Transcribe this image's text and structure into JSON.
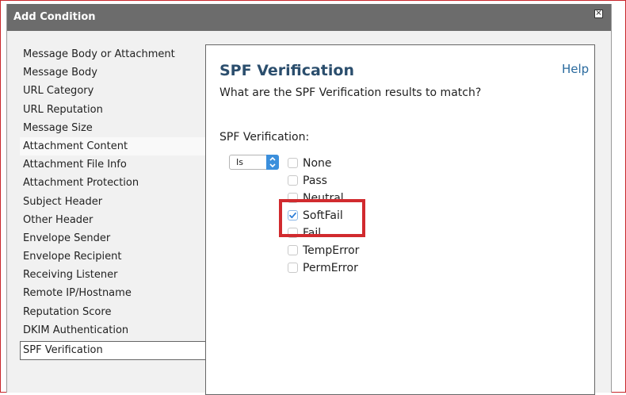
{
  "dialog": {
    "title": "Add Condition",
    "close_icon": "close-icon"
  },
  "sidebar": {
    "items": [
      {
        "label": "Message Body or Attachment"
      },
      {
        "label": "Message Body"
      },
      {
        "label": "URL Category"
      },
      {
        "label": "URL Reputation"
      },
      {
        "label": "Message Size"
      },
      {
        "label": "Attachment Content"
      },
      {
        "label": "Attachment File Info"
      },
      {
        "label": "Attachment Protection"
      },
      {
        "label": "Subject Header"
      },
      {
        "label": "Other Header"
      },
      {
        "label": "Envelope Sender"
      },
      {
        "label": "Envelope Recipient"
      },
      {
        "label": "Receiving Listener"
      },
      {
        "label": "Remote IP/Hostname"
      },
      {
        "label": "Reputation Score"
      },
      {
        "label": "DKIM Authentication"
      },
      {
        "label": "SPF Verification",
        "selected": true
      }
    ]
  },
  "panel": {
    "title": "SPF Verification",
    "help": "Help",
    "question": "What are the SPF Verification results to match?",
    "field_label": "SPF Verification:",
    "operator": "Is",
    "options": [
      {
        "label": "None",
        "checked": false
      },
      {
        "label": "Pass",
        "checked": false
      },
      {
        "label": "Neutral",
        "checked": false
      },
      {
        "label": "SoftFail",
        "checked": true
      },
      {
        "label": "Fail",
        "checked": false
      },
      {
        "label": "TempError",
        "checked": false
      },
      {
        "label": "PermError",
        "checked": false
      }
    ]
  },
  "colors": {
    "titlebar": "#6c6c6c",
    "panel_title": "#2b4e6d",
    "help_link": "#2a6a9e",
    "highlight": "#d12a2e",
    "select_accent": "#3b8fdc",
    "checkbox_check": "#2f7fd8"
  }
}
